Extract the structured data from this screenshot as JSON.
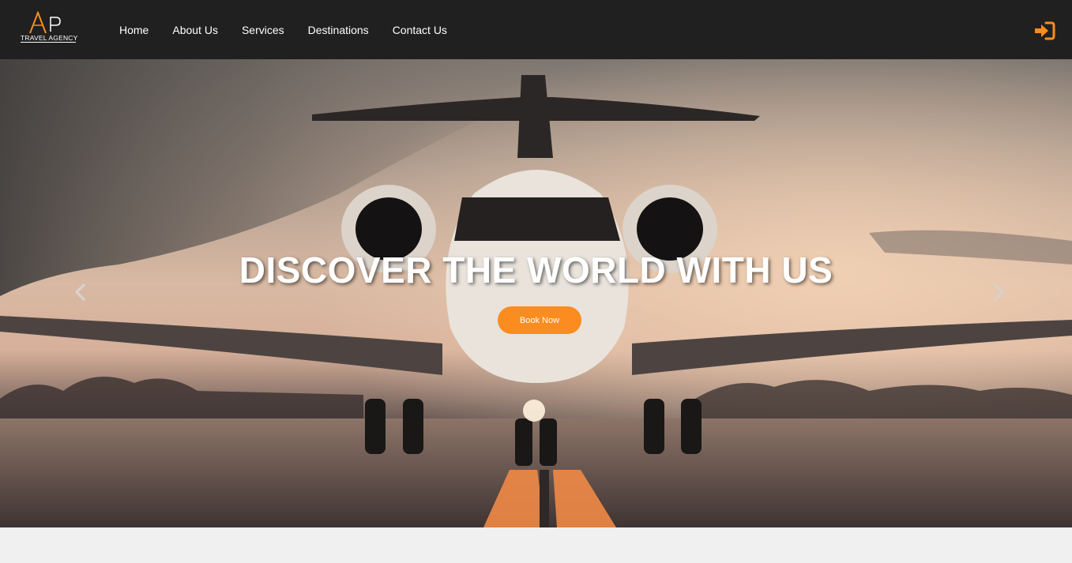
{
  "brand": {
    "logo_letters": "AP",
    "logo_text": "TRAVEL AGENCY",
    "accent_color": "#fb8c1f"
  },
  "nav": {
    "items": [
      {
        "label": "Home"
      },
      {
        "label": "About Us"
      },
      {
        "label": "Services"
      },
      {
        "label": "Destinations"
      },
      {
        "label": "Contact Us"
      }
    ],
    "login_icon": "sign-in-icon"
  },
  "hero": {
    "title": "DISCOVER THE WORLD WITH US",
    "cta_label": "Book Now",
    "image_subject": "private jet on runway at sunset",
    "prev_icon": "chevron-left-icon",
    "next_icon": "chevron-right-icon"
  },
  "colors": {
    "navbar_bg": "#202020",
    "page_bg": "#f0f0f0",
    "button_bg": "#fb8c1f"
  }
}
